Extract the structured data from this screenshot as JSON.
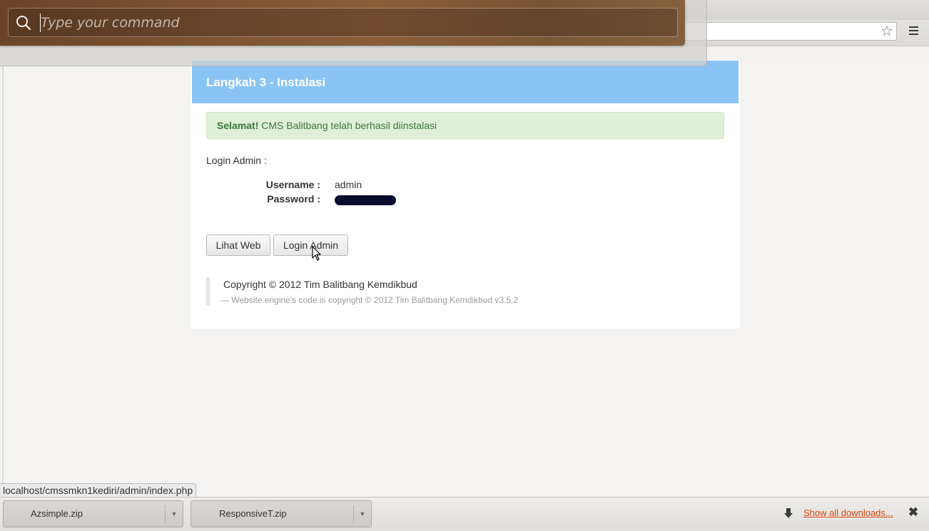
{
  "hud": {
    "placeholder": "Type your command",
    "icon": "search-icon"
  },
  "browser": {
    "bookmark_icon": "star-icon",
    "menu_icon": "menu-icon"
  },
  "panel": {
    "title": "Langkah 3 - Instalasi",
    "alert_strong": "Selamat!",
    "alert_text": " CMS Balitbang telah berhasil diinstalasi",
    "login_label": "Login Admin :",
    "username_label": "Username :",
    "username_value": "admin",
    "password_label": "Password :",
    "buttons": {
      "view_web": "Lihat Web",
      "login_admin": "Login Admin"
    },
    "copyright": "Copyright © 2012 Tim Balitbang Kemdikbud",
    "engine_note": "— Website engine's code is copyright © 2012 Tim Balitbang Kemdikbud v3.5.2"
  },
  "status_url": "localhost/cmssmkn1kediri/admin/index.php",
  "downloads": {
    "items": [
      {
        "name": "Azsimple.zip"
      },
      {
        "name": "ResponsiveT.zip"
      }
    ],
    "show_all": "Show all downloads..."
  },
  "colors": {
    "header_bg": "#89c4f4",
    "alert_bg": "#dff0d8",
    "alert_text": "#3c763d",
    "link": "#dd4814"
  }
}
